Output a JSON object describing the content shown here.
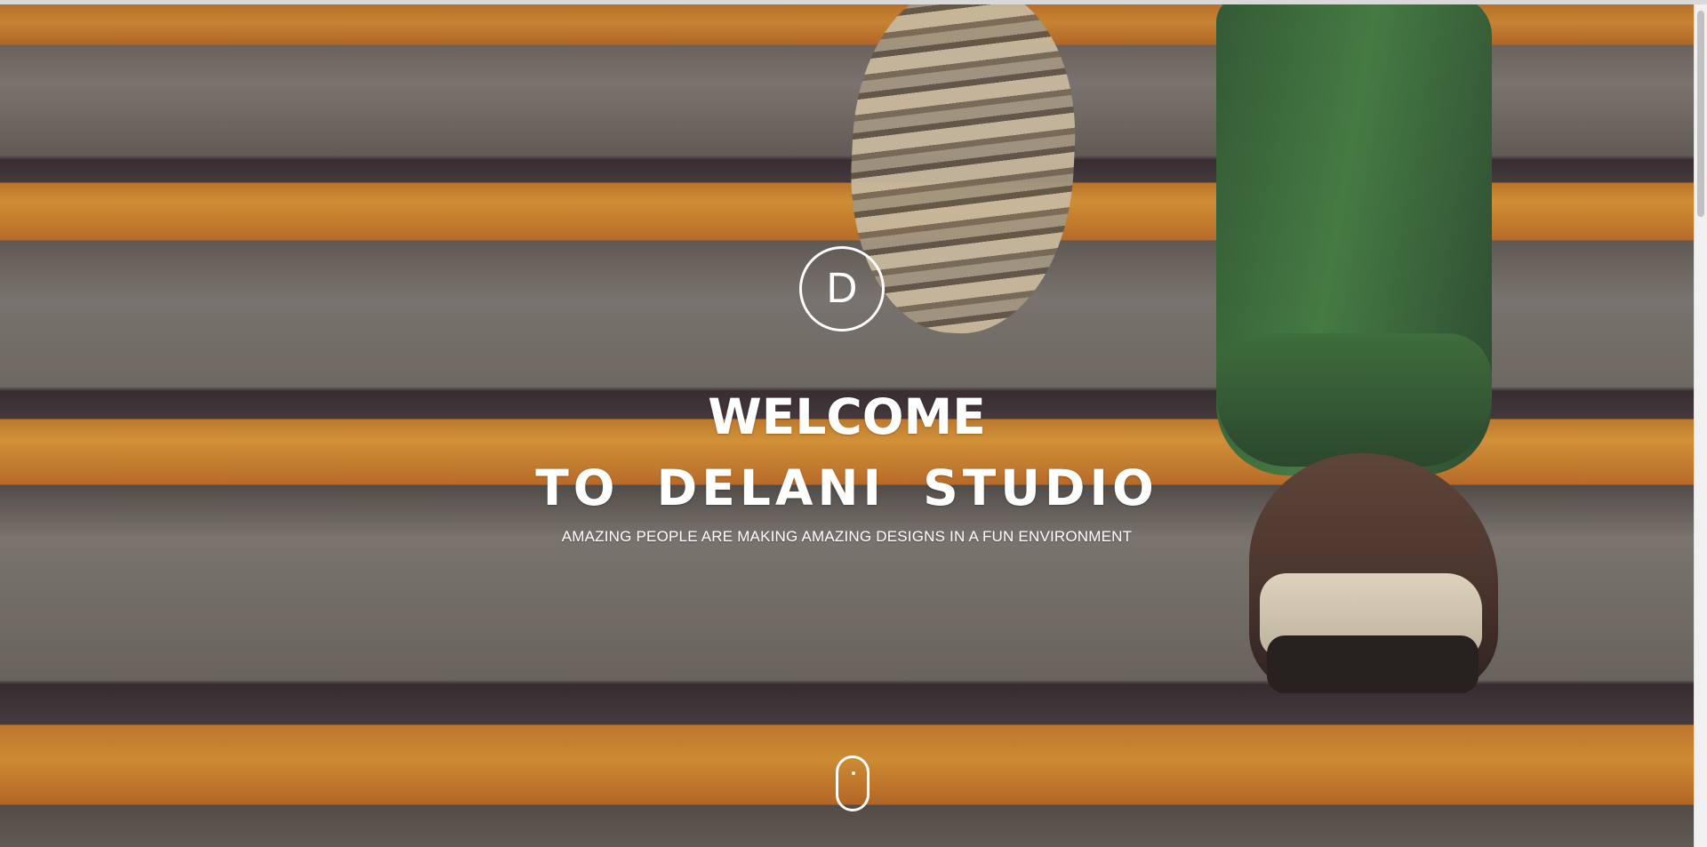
{
  "hero": {
    "logo_letter": "D",
    "title_line1": "WELCOME",
    "title_line2": "TO DELANI STUDIO",
    "subtitle": "AMAZING PEOPLE ARE MAKING AMAZING DESIGNS IN A FUN ENVIRONMENT",
    "scroll_icon": "mouse-scroll-icon"
  },
  "colors": {
    "text": "#ffffff",
    "stair_orange": "#f4aa3e",
    "stair_gray": "#8b8580",
    "scrollbar_thumb": "#c1c1c1"
  }
}
